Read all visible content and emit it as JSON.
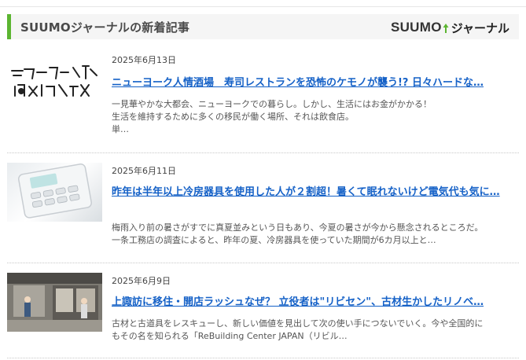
{
  "header": {
    "title": "SUUMOジャーナルの新着記事",
    "brand_suumo": "SUUMO",
    "brand_journal": "ジャーナル"
  },
  "articles": [
    {
      "date": "2025年6月13日",
      "title": "ニューヨーク人情酒場　寿司レストランを恐怖のケモノが襲う!? 日々ハードな…",
      "excerpt_lines": [
        "一見華やかな大都会、ニューヨークでの暮らし。しかし、生活にはお金がかかる！",
        "生活を維持するために多くの移民が働く場所、それは飲食店。",
        "単…"
      ],
      "thumb_text": [
        "ニューヨーク人情酒場",
        "NY"
      ]
    },
    {
      "date": "2025年6月11日",
      "title": "昨年は半年以上冷房器具を使用した人が２割超！暑くて眠れないけど電気代も気に…",
      "excerpt_lines": [
        "梅雨入り前の暑さがすでに真夏並みという日もあり、今夏の暑さが今から懸念されるところだ。",
        "一条工務店の調査によると、昨年の夏、冷房器具を使っていた期間が6カ月以上と…"
      ]
    },
    {
      "date": "2025年6月9日",
      "title": "上諏訪に移住・開店ラッシュなぜ？ 立役者は\"リビセン\"、古材生かしたリノベ…",
      "excerpt_lines": [
        "古材と古道具をレスキューし、新しい価値を見出して次の使い手につないでいく。今や全国的に",
        "もその名を知られる「ReBuilding Center JAPAN（リビル…"
      ]
    }
  ],
  "colors": {
    "accent": "#5cb531",
    "link": "#1561c7",
    "header_bg": "#f5f5f5"
  }
}
